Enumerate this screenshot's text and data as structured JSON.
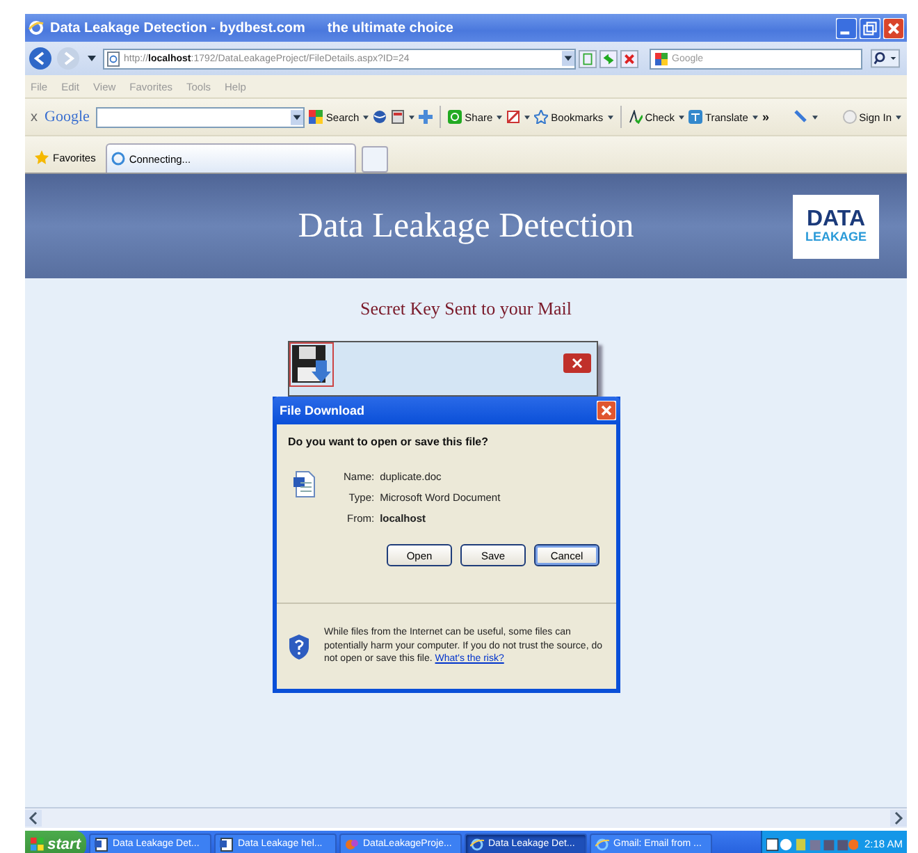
{
  "window": {
    "title": "Data Leakage Detection - bydbest.com",
    "title_suffix": "the ultimate choice"
  },
  "address_bar": {
    "url": "http://**localhost**:1792/DataLeakageProject/FileDetails.aspx?ID=24",
    "search_placeholder": "Google"
  },
  "menu": [
    "File",
    "Edit",
    "View",
    "Favorites",
    "Tools",
    "Help"
  ],
  "google_toolbar": {
    "close": "x",
    "logo": "Google",
    "items": [
      {
        "kind": "search",
        "label": "Search"
      },
      {
        "kind": "share",
        "label": "Share"
      },
      {
        "kind": "bookmarks",
        "label": "Bookmarks"
      },
      {
        "kind": "check",
        "label": "Check"
      },
      {
        "kind": "translate",
        "label": "Translate"
      },
      {
        "kind": "more",
        "label": "»"
      },
      {
        "kind": "signin",
        "label": "Sign In"
      }
    ]
  },
  "favorites_bar": {
    "label": "Favorites",
    "tab": "Connecting..."
  },
  "page": {
    "heading": "Data Leakage Detection",
    "logo": [
      "DATA",
      "LEAKAGE"
    ],
    "message": "Secret Key Sent to your Mail"
  },
  "download_dialog": {
    "title": "File Download",
    "question": "Do you want to open or save this file?",
    "fields": [
      {
        "label": "Name:",
        "value": "duplicate.doc",
        "bold": false
      },
      {
        "label": "Type:",
        "value": "Microsoft Word Document",
        "bold": false
      },
      {
        "label": "From:",
        "value": "localhost",
        "bold": true
      }
    ],
    "buttons": [
      {
        "label": "Open",
        "default": false
      },
      {
        "label": "Save",
        "default": false
      },
      {
        "label": "Cancel",
        "default": true
      }
    ],
    "warning": "While files from the Internet can be useful, some files can potentially harm your computer. If you do not trust the source, do not open or save this file.",
    "link": "What's the risk?"
  },
  "taskbar": {
    "start": "start",
    "tasks": [
      {
        "label": "Data Leakage Det...",
        "kind": "document",
        "selected": false
      },
      {
        "label": "Data Leakage hel...",
        "kind": "document",
        "selected": false
      },
      {
        "label": "DataLeakageProje...",
        "kind": "project",
        "selected": false
      },
      {
        "label": "Data Leakage Det...",
        "kind": "browser",
        "selected": true
      },
      {
        "label": "Gmail: Email from ...",
        "kind": "browser",
        "selected": false
      }
    ],
    "clock": "2:18 AM"
  }
}
